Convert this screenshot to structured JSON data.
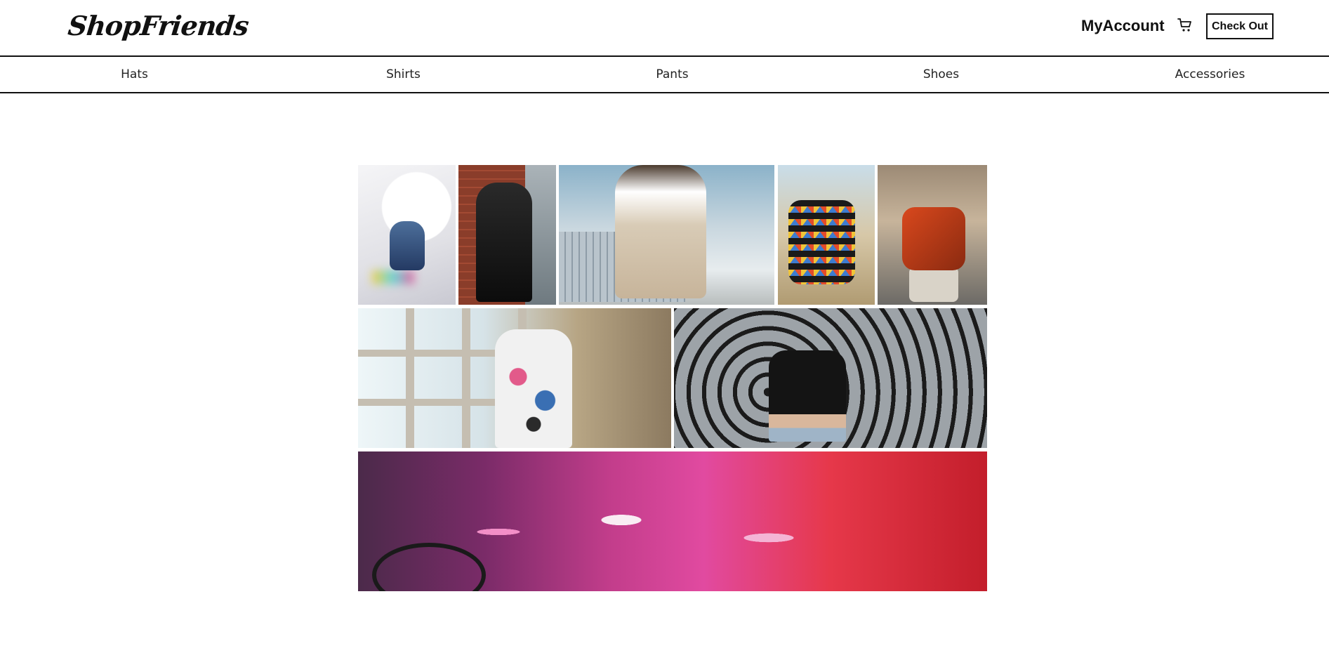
{
  "header": {
    "logo": "ShopFriends",
    "account_label": "MyAccount",
    "cart_icon": "cart-icon",
    "checkout_label": "Check Out"
  },
  "nav": {
    "items": [
      "Hats",
      "Shirts",
      "Pants",
      "Shoes",
      "Accessories"
    ]
  },
  "gallery": {
    "tiles": [
      "streetwear-photo-1",
      "streetwear-photo-2",
      "streetwear-photo-3",
      "streetwear-photo-4",
      "streetwear-photo-5",
      "streetwear-photo-6",
      "streetwear-photo-7",
      "streetwear-photo-8"
    ]
  },
  "colors": {
    "text": "#111111",
    "background": "#ffffff",
    "border": "#111111"
  }
}
